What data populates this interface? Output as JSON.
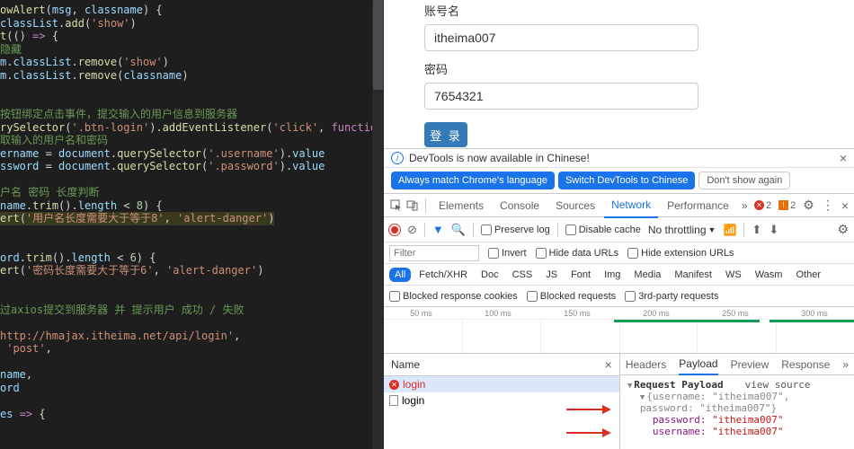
{
  "code": {
    "raw": "owAlert(msg, classname) {\nclassList.add('show')\nt(() => {\n隐藏\nm.classList.remove('show')\nm.classList.remove(classname)\n\n\n按钮绑定点击事件，提交输入的用户信息到服务器\nrySelector('.btn-login').addEventListener('click', function ()\n取输入的用户名和密码\nername = document.querySelector('.username').value\nssword = document.querySelector('.password').value\n\n户名 密码 长度判断\nname.trim().length < 8) {\nert('用户名长度需要大于等于8', 'alert-danger')\n\n\nord.trim().length < 6) {\nert('密码长度需要大于等于6', 'alert-danger')\n\n\n过axios提交到服务器 并 提示用户 成功 / 失败\n\nhttp://hmajax.itheima.net/api/login',\n 'post',\n\nname,\nord\n\nes => {"
  },
  "form": {
    "username_label": "账号名",
    "username_value": "itheima007",
    "password_label": "密码",
    "password_value": "7654321",
    "login_button": "登 录"
  },
  "infobar": {
    "message": "DevTools is now available in Chinese!",
    "always_match": "Always match Chrome's language",
    "switch_to": "Switch DevTools to Chinese",
    "dont_show": "Don't show again"
  },
  "main_tabs": {
    "elements": "Elements",
    "console": "Console",
    "sources": "Sources",
    "network": "Network",
    "performance": "Performance"
  },
  "badges": {
    "errors": "2",
    "warnings": "2"
  },
  "net_toolbar": {
    "preserve_log": "Preserve log",
    "disable_cache": "Disable cache",
    "no_throttling": "No throttling"
  },
  "filter": {
    "placeholder": "Filter",
    "invert": "Invert",
    "hide_data_urls": "Hide data URLs",
    "hide_ext_urls": "Hide extension URLs"
  },
  "types": {
    "all": "All",
    "fetch_xhr": "Fetch/XHR",
    "doc": "Doc",
    "css": "CSS",
    "js": "JS",
    "font": "Font",
    "img": "Img",
    "media": "Media",
    "manifest": "Manifest",
    "ws": "WS",
    "wasm": "Wasm",
    "other": "Other"
  },
  "blocked": {
    "cookies": "Blocked response cookies",
    "requests": "Blocked requests",
    "third_party": "3rd-party requests"
  },
  "timeline": {
    "ticks": [
      "50 ms",
      "100 ms",
      "150 ms",
      "200 ms",
      "250 ms",
      "300 ms"
    ]
  },
  "requests": {
    "name_header": "Name",
    "items": [
      {
        "name": "login",
        "error": true,
        "selected": true
      },
      {
        "name": "login",
        "error": false,
        "selected": false
      }
    ]
  },
  "detail": {
    "headers": "Headers",
    "payload": "Payload",
    "preview": "Preview",
    "response": "Response",
    "request_payload": "Request Payload",
    "view_source": "view source",
    "obj_summary": "{username: \"itheima007\", password: \"itheima007\"}",
    "password_key": "password:",
    "password_val": "\"itheima007\"",
    "username_key": "username:",
    "username_val": "\"itheima007\""
  }
}
